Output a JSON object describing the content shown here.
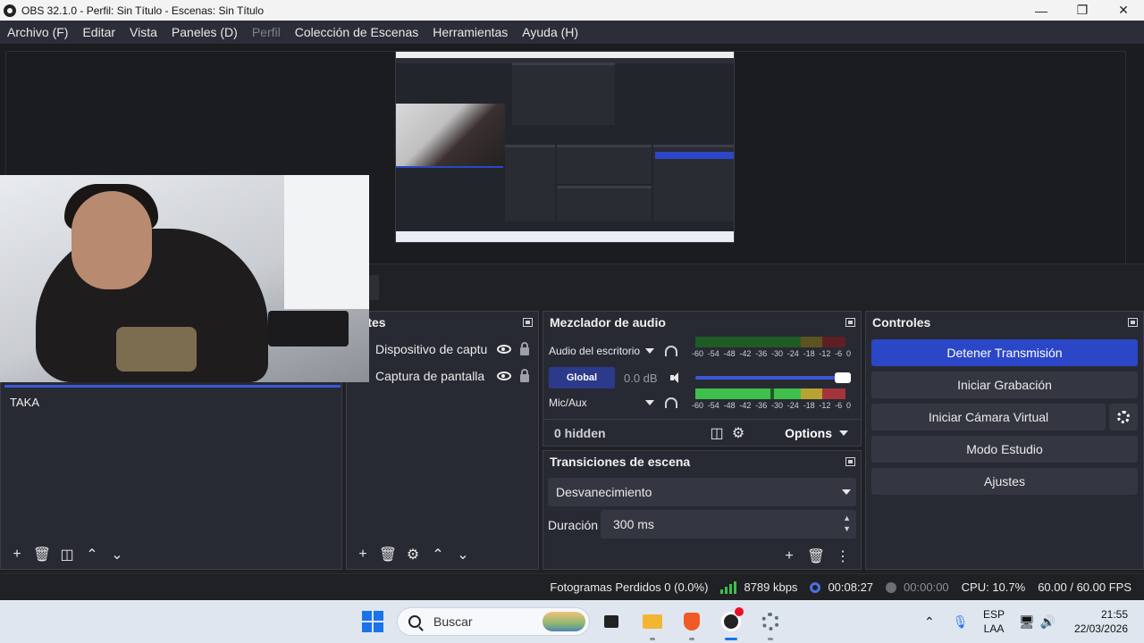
{
  "window": {
    "title": "OBS 32.1.0 - Perfil: Sin Título - Escenas: Sin Título",
    "controls": [
      "minimize-icon",
      "maximize-icon",
      "close-icon"
    ]
  },
  "menu": {
    "archivo": "Archivo (F)",
    "editar": "Editar",
    "vista": "Vista",
    "paneles": "Paneles (D)",
    "perfil": "Perfil",
    "coleccion": "Colección de Escenas",
    "herramientas": "Herramientas",
    "ayuda": "Ayuda (H)"
  },
  "scenes": {
    "items": [
      "TAKA"
    ]
  },
  "sources": {
    "title": "entes",
    "items": [
      {
        "label": "Dispositivo de captu"
      },
      {
        "label": "Captura de pantalla"
      }
    ]
  },
  "mixer": {
    "title": "Mezclador de audio",
    "channels": [
      {
        "name": "Audio del escritorio"
      },
      {
        "name": "Mic/Aux"
      }
    ],
    "global_label": "Global",
    "global_db": "0.0 dB",
    "ticks": [
      "-60",
      "-54",
      "-48",
      "-42",
      "-36",
      "-30",
      "-24",
      "-18",
      "-12",
      "-6",
      "0"
    ],
    "hidden_label": "0 hidden",
    "options_label": "Options"
  },
  "transitions": {
    "title": "Transiciones de escena",
    "selected": "Desvanecimiento",
    "duration_label": "Duración",
    "duration_value": "300 ms"
  },
  "controls": {
    "title": "Controles",
    "stop_stream": "Detener Transmisión",
    "start_recording": "Iniciar Grabación",
    "start_virtual_cam": "Iniciar Cámara Virtual",
    "studio_mode": "Modo Estudio",
    "settings": "Ajustes"
  },
  "status": {
    "dropped_frames": "Fotogramas Perdidos 0 (0.0%)",
    "bitrate": "8789 kbps",
    "stream_time": "00:08:27",
    "record_time": "00:00:00",
    "cpu": "CPU: 10.7%",
    "fps": "60.00 / 60.00 FPS"
  },
  "taskbar": {
    "search_placeholder": "Buscar",
    "language": "ESP",
    "layout": "LAA",
    "time": "21:55",
    "date": "22/03/2026"
  },
  "colors": {
    "accent_blue": "#2b47c7",
    "meter_green": "#3fbf4c",
    "meter_yellow": "#b7a233",
    "meter_red": "#a3343a"
  }
}
